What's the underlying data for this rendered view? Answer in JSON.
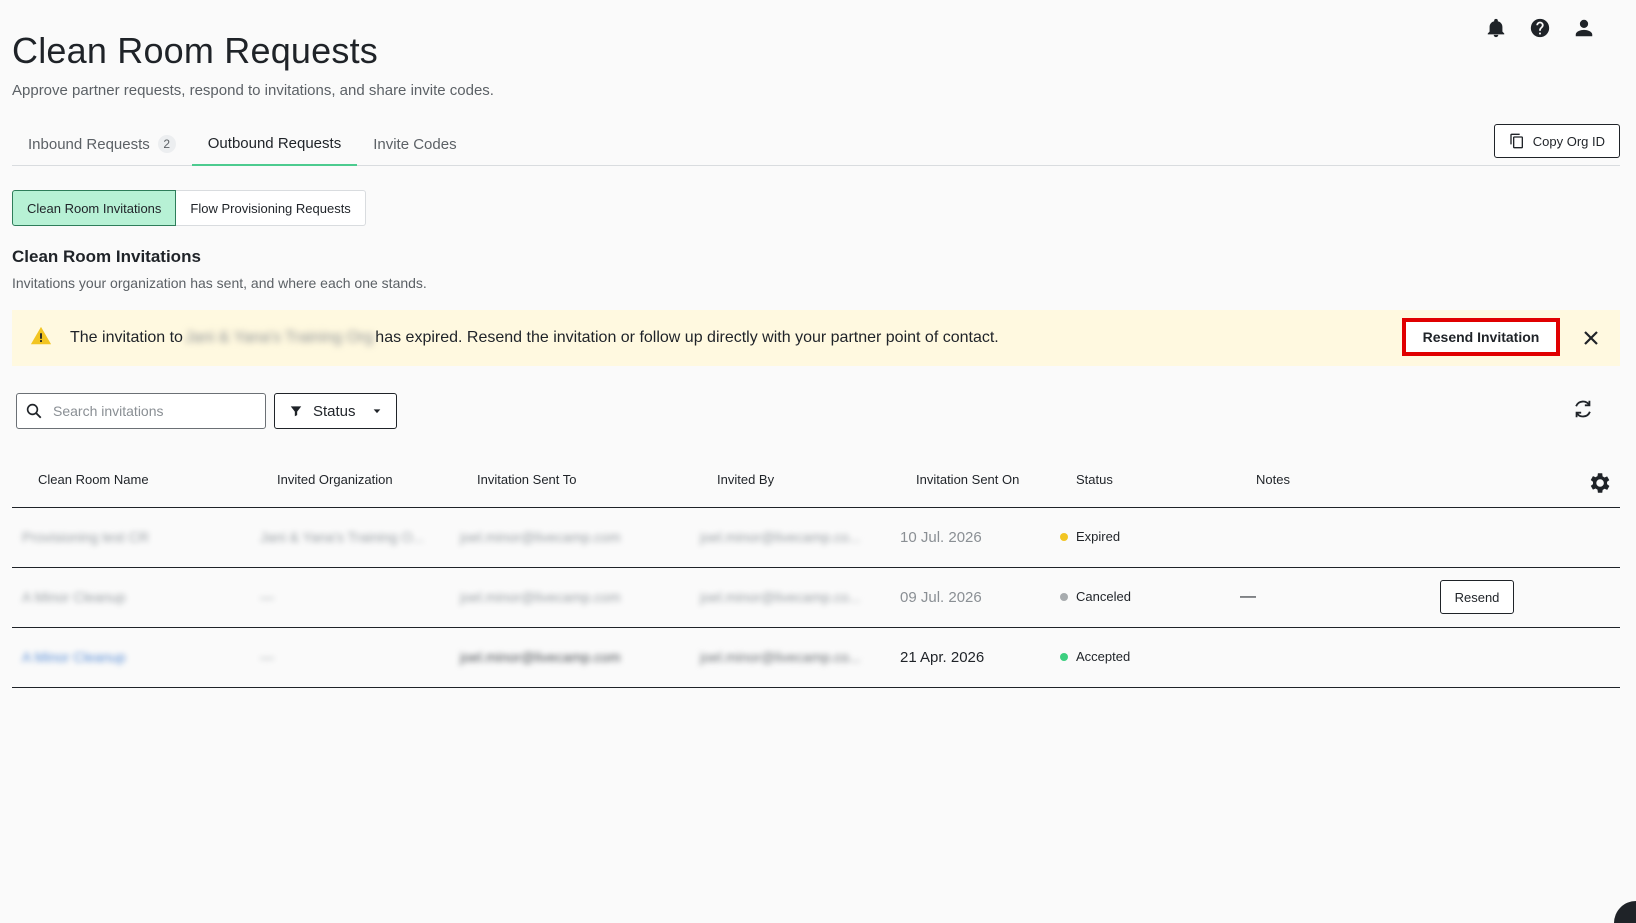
{
  "header": {
    "title": "Clean Room Requests",
    "subtitle": "Approve partner requests, respond to invitations, and share invite codes."
  },
  "top_icons": [
    "bell-icon",
    "help-icon",
    "user-icon"
  ],
  "tabs": [
    {
      "label": "Inbound Requests",
      "count": "2"
    },
    {
      "label": "Outbound Requests"
    },
    {
      "label": "Invite Codes"
    }
  ],
  "copy_org_id_label": "Copy Org ID",
  "segments": [
    {
      "label": "Clean Room Invitations",
      "active": true
    },
    {
      "label": "Flow Provisioning Requests",
      "active": false
    }
  ],
  "section": {
    "title": "Clean Room Invitations",
    "subtitle": "Invitations your organization has sent, and where each one stands."
  },
  "alert": {
    "prefix": "The invitation to",
    "org": "Jani & Yana's Training Org",
    "suffix": "has expired. Resend the invitation or follow up directly with your partner point of contact.",
    "button": "Resend Invitation"
  },
  "search": {
    "placeholder": "Search invitations"
  },
  "status_filter_label": "Status",
  "columns": [
    "Clean Room Name",
    "Invited Organization",
    "Invitation Sent To",
    "Invited By",
    "Invitation Sent On",
    "Status",
    "Notes"
  ],
  "rows": [
    {
      "name": "Provisioning test CR",
      "org": "Jani & Yana's Training O...",
      "sent_to": "joel.minor@livecamp.com",
      "invited_by": "joel.minor@livecamp.co...",
      "date": "10 Jul. 2026",
      "status": "Expired",
      "status_color": "#f2c522",
      "notes": ""
    },
    {
      "name": "A Minor Cleanup",
      "org": "—",
      "sent_to": "joel.minor@livecamp.com",
      "invited_by": "joel.minor@livecamp.co...",
      "date": "09 Jul. 2026",
      "status": "Canceled",
      "status_color": "#a7abae",
      "notes": "—",
      "action": "Resend"
    },
    {
      "name": "A Minor Cleanup",
      "org": "—",
      "sent_to": "joel.minor@livecamp.com",
      "invited_by": "joel.minor@livecamp.co...",
      "date": "21 Apr. 2026",
      "status": "Accepted",
      "status_color": "#3ccf7f",
      "notes": ""
    }
  ]
}
